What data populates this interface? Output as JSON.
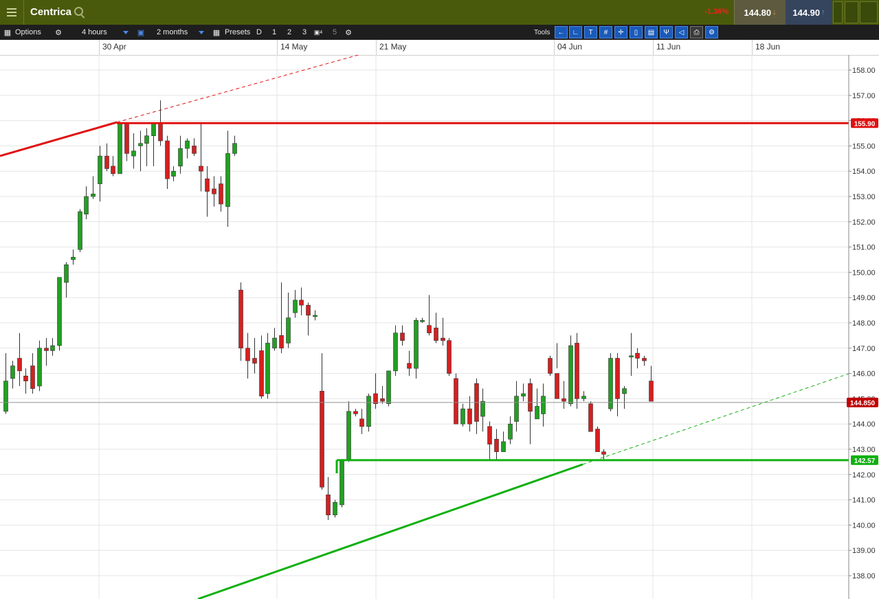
{
  "header": {
    "instrument": "Centrica",
    "change_pct": "-1.36%",
    "sell_price": "144.80",
    "buy_price": "144.90"
  },
  "toolbar": {
    "options_label": "Options",
    "interval_value": "4 hours",
    "range_value": "2 months",
    "presets_label": "Presets",
    "preset_d": "D",
    "preset_1": "1",
    "preset_2": "2",
    "preset_3": "3",
    "preset_4": "4",
    "preset_5": "5",
    "tools_label": "Tools"
  },
  "icons": [
    "menu-icon",
    "search-icon",
    "options-icon",
    "gear-icon",
    "lock-icon",
    "calendar-icon",
    "back-icon",
    "curve-icon",
    "text-icon",
    "grid-icon",
    "crosshair-icon",
    "candle-icon",
    "layers-icon",
    "pitchfork-icon",
    "tag-icon",
    "print-icon",
    "settings-icon"
  ],
  "colors": {
    "up": "#22a022",
    "down": "#d42020",
    "resistance": "#e01010",
    "support": "#10b010",
    "header": "#4a5a0c"
  },
  "chart_data": {
    "type": "candlestick",
    "x_labels": [
      "30 Apr",
      "14 May",
      "21 May",
      "04 Jun",
      "11 Jun",
      "18 Jun"
    ],
    "y_ticks": [
      "158.00",
      "157.00",
      "156.00",
      "155.00",
      "154.00",
      "153.00",
      "152.00",
      "151.00",
      "150.00",
      "149.00",
      "148.00",
      "147.00",
      "146.00",
      "145.00",
      "144.00",
      "143.00",
      "142.00",
      "141.00",
      "140.00",
      "139.00",
      "138.00"
    ],
    "ylim": [
      137.8,
      158.4
    ],
    "grid": true,
    "candles": [
      {
        "o": 144.5,
        "h": 146.8,
        "l": 144.4,
        "c": 145.7
      },
      {
        "o": 145.8,
        "h": 146.5,
        "l": 145.4,
        "c": 146.3
      },
      {
        "o": 146.6,
        "h": 147.6,
        "l": 145.5,
        "c": 146.1
      },
      {
        "o": 145.9,
        "h": 146.2,
        "l": 145.2,
        "c": 145.7
      },
      {
        "o": 146.3,
        "h": 146.8,
        "l": 145.2,
        "c": 145.4
      },
      {
        "o": 145.5,
        "h": 147.3,
        "l": 145.3,
        "c": 147.0
      },
      {
        "o": 147.0,
        "h": 147.4,
        "l": 146.3,
        "c": 146.9
      },
      {
        "o": 146.9,
        "h": 147.4,
        "l": 146.7,
        "c": 147.1
      },
      {
        "o": 147.1,
        "h": 149.8,
        "l": 146.9,
        "c": 149.8
      },
      {
        "o": 149.6,
        "h": 150.4,
        "l": 149.0,
        "c": 150.3
      },
      {
        "o": 150.5,
        "h": 150.9,
        "l": 150.3,
        "c": 150.6
      },
      {
        "o": 150.9,
        "h": 152.5,
        "l": 150.8,
        "c": 152.4
      },
      {
        "o": 152.3,
        "h": 153.4,
        "l": 152.1,
        "c": 153.0
      },
      {
        "o": 153.0,
        "h": 153.8,
        "l": 152.9,
        "c": 153.1
      },
      {
        "o": 153.5,
        "h": 155.0,
        "l": 152.8,
        "c": 154.6
      },
      {
        "o": 154.6,
        "h": 155.1,
        "l": 154.0,
        "c": 154.1
      },
      {
        "o": 154.2,
        "h": 154.6,
        "l": 153.8,
        "c": 153.9
      },
      {
        "o": 153.9,
        "h": 155.9,
        "l": 153.9,
        "c": 155.9
      },
      {
        "o": 155.9,
        "h": 155.9,
        "l": 154.4,
        "c": 154.7
      },
      {
        "o": 154.6,
        "h": 155.5,
        "l": 154.1,
        "c": 154.8
      },
      {
        "o": 155.0,
        "h": 155.6,
        "l": 154.0,
        "c": 155.1
      },
      {
        "o": 155.1,
        "h": 155.7,
        "l": 154.2,
        "c": 155.4
      },
      {
        "o": 155.4,
        "h": 155.9,
        "l": 154.2,
        "c": 155.9
      },
      {
        "o": 155.9,
        "h": 156.8,
        "l": 155.0,
        "c": 155.2
      },
      {
        "o": 155.2,
        "h": 155.4,
        "l": 153.3,
        "c": 153.7
      },
      {
        "o": 153.8,
        "h": 154.2,
        "l": 153.6,
        "c": 154.0
      },
      {
        "o": 154.2,
        "h": 155.4,
        "l": 153.9,
        "c": 154.9
      },
      {
        "o": 154.9,
        "h": 155.3,
        "l": 154.5,
        "c": 155.2
      },
      {
        "o": 155.0,
        "h": 155.3,
        "l": 154.6,
        "c": 154.7
      },
      {
        "o": 154.2,
        "h": 155.9,
        "l": 153.2,
        "c": 154.0
      },
      {
        "o": 153.7,
        "h": 154.2,
        "l": 152.2,
        "c": 153.2
      },
      {
        "o": 153.3,
        "h": 153.8,
        "l": 152.6,
        "c": 153.1
      },
      {
        "o": 153.5,
        "h": 153.8,
        "l": 152.4,
        "c": 152.7
      },
      {
        "o": 152.6,
        "h": 155.6,
        "l": 151.8,
        "c": 154.7
      },
      {
        "o": 154.7,
        "h": 155.4,
        "l": 154.6,
        "c": 155.1
      },
      {
        "o": 149.3,
        "h": 149.6,
        "l": 146.5,
        "c": 147.0
      },
      {
        "o": 147.0,
        "h": 147.6,
        "l": 145.8,
        "c": 146.5
      },
      {
        "o": 146.6,
        "h": 147.4,
        "l": 146.0,
        "c": 146.4
      },
      {
        "o": 146.9,
        "h": 147.5,
        "l": 145.0,
        "c": 145.1
      },
      {
        "o": 145.2,
        "h": 147.6,
        "l": 145.0,
        "c": 147.2
      },
      {
        "o": 147.0,
        "h": 147.8,
        "l": 146.9,
        "c": 147.4
      },
      {
        "o": 147.5,
        "h": 149.6,
        "l": 146.8,
        "c": 147.0
      },
      {
        "o": 147.2,
        "h": 149.2,
        "l": 147.0,
        "c": 148.2
      },
      {
        "o": 148.4,
        "h": 149.3,
        "l": 148.2,
        "c": 148.9
      },
      {
        "o": 148.9,
        "h": 149.4,
        "l": 148.3,
        "c": 148.7
      },
      {
        "o": 148.7,
        "h": 148.8,
        "l": 147.5,
        "c": 148.3
      },
      {
        "o": 148.3,
        "h": 148.5,
        "l": 148.1,
        "c": 148.3
      },
      {
        "o": 145.3,
        "h": 146.8,
        "l": 141.4,
        "c": 141.5
      },
      {
        "o": 141.2,
        "h": 141.9,
        "l": 140.2,
        "c": 140.4
      },
      {
        "o": 140.4,
        "h": 141.0,
        "l": 140.3,
        "c": 140.9
      },
      {
        "o": 140.8,
        "h": 142.6,
        "l": 140.7,
        "c": 142.6
      },
      {
        "o": 142.6,
        "h": 144.9,
        "l": 142.5,
        "c": 144.5
      },
      {
        "o": 144.5,
        "h": 144.6,
        "l": 144.3,
        "c": 144.4
      },
      {
        "o": 144.2,
        "h": 144.6,
        "l": 143.6,
        "c": 143.9
      },
      {
        "o": 143.9,
        "h": 145.2,
        "l": 143.7,
        "c": 145.1
      },
      {
        "o": 145.2,
        "h": 146.0,
        "l": 144.6,
        "c": 144.8
      },
      {
        "o": 145.0,
        "h": 145.5,
        "l": 144.8,
        "c": 144.9
      },
      {
        "o": 144.8,
        "h": 146.1,
        "l": 144.7,
        "c": 146.1
      },
      {
        "o": 146.1,
        "h": 147.9,
        "l": 145.9,
        "c": 147.6
      },
      {
        "o": 147.6,
        "h": 147.9,
        "l": 147.1,
        "c": 147.3
      },
      {
        "o": 146.4,
        "h": 146.9,
        "l": 145.9,
        "c": 146.2
      },
      {
        "o": 146.2,
        "h": 148.2,
        "l": 145.8,
        "c": 148.1
      },
      {
        "o": 148.1,
        "h": 148.2,
        "l": 148.0,
        "c": 148.1
      },
      {
        "o": 147.9,
        "h": 149.1,
        "l": 147.5,
        "c": 147.6
      },
      {
        "o": 147.8,
        "h": 148.4,
        "l": 147.2,
        "c": 147.3
      },
      {
        "o": 147.4,
        "h": 148.2,
        "l": 147.1,
        "c": 147.3
      },
      {
        "o": 147.3,
        "h": 147.4,
        "l": 145.9,
        "c": 146.0
      },
      {
        "o": 145.8,
        "h": 146.0,
        "l": 144.7,
        "c": 144.0
      },
      {
        "o": 144.0,
        "h": 144.8,
        "l": 143.9,
        "c": 144.6
      },
      {
        "o": 144.6,
        "h": 145.1,
        "l": 143.7,
        "c": 144.0
      },
      {
        "o": 145.6,
        "h": 145.8,
        "l": 143.6,
        "c": 144.1
      },
      {
        "o": 144.3,
        "h": 145.4,
        "l": 143.7,
        "c": 144.9
      },
      {
        "o": 143.9,
        "h": 144.1,
        "l": 142.6,
        "c": 143.2
      },
      {
        "o": 143.4,
        "h": 143.8,
        "l": 142.6,
        "c": 142.9
      },
      {
        "o": 142.9,
        "h": 143.7,
        "l": 142.9,
        "c": 143.3
      },
      {
        "o": 143.4,
        "h": 144.3,
        "l": 143.2,
        "c": 144.0
      },
      {
        "o": 144.1,
        "h": 145.7,
        "l": 143.7,
        "c": 145.1
      },
      {
        "o": 145.1,
        "h": 145.6,
        "l": 144.9,
        "c": 145.2
      },
      {
        "o": 145.6,
        "h": 145.8,
        "l": 143.2,
        "c": 144.5
      },
      {
        "o": 144.2,
        "h": 145.4,
        "l": 144.2,
        "c": 144.7
      },
      {
        "o": 144.4,
        "h": 145.6,
        "l": 143.9,
        "c": 145.1
      },
      {
        "o": 146.6,
        "h": 146.7,
        "l": 145.9,
        "c": 146.0
      },
      {
        "o": 146.0,
        "h": 147.2,
        "l": 146.2,
        "c": 145.0
      },
      {
        "o": 145.0,
        "h": 145.7,
        "l": 144.6,
        "c": 144.9
      },
      {
        "o": 144.8,
        "h": 147.5,
        "l": 144.7,
        "c": 147.1
      },
      {
        "o": 147.2,
        "h": 147.6,
        "l": 144.6,
        "c": 145.0
      },
      {
        "o": 145.0,
        "h": 145.3,
        "l": 144.9,
        "c": 145.1
      },
      {
        "o": 144.8,
        "h": 144.9,
        "l": 143.8,
        "c": 143.7
      },
      {
        "o": 143.8,
        "h": 143.9,
        "l": 142.9,
        "c": 142.9
      },
      {
        "o": 142.9,
        "h": 143.0,
        "l": 142.6,
        "c": 142.8
      },
      {
        "o": 144.6,
        "h": 146.8,
        "l": 144.5,
        "c": 146.6
      },
      {
        "o": 146.6,
        "h": 146.8,
        "l": 144.3,
        "c": 145.0
      },
      {
        "o": 145.2,
        "h": 145.5,
        "l": 144.6,
        "c": 145.4
      },
      {
        "o": 146.7,
        "h": 147.6,
        "l": 145.9,
        "c": 146.7
      },
      {
        "o": 146.8,
        "h": 147.0,
        "l": 146.2,
        "c": 146.6
      },
      {
        "o": 146.6,
        "h": 146.7,
        "l": 146.3,
        "c": 146.5
      },
      {
        "o": 145.7,
        "h": 146.3,
        "l": 144.9,
        "c": 144.9
      }
    ],
    "horizontal_lines": [
      {
        "name": "resistance",
        "value": 155.9,
        "label": "155.90",
        "color": "#e01010"
      },
      {
        "name": "support",
        "value": 142.57,
        "label": "142.57",
        "color": "#10b010"
      },
      {
        "name": "current-price",
        "value": 144.85,
        "label": "144.850",
        "color": "#c00000"
      }
    ]
  }
}
